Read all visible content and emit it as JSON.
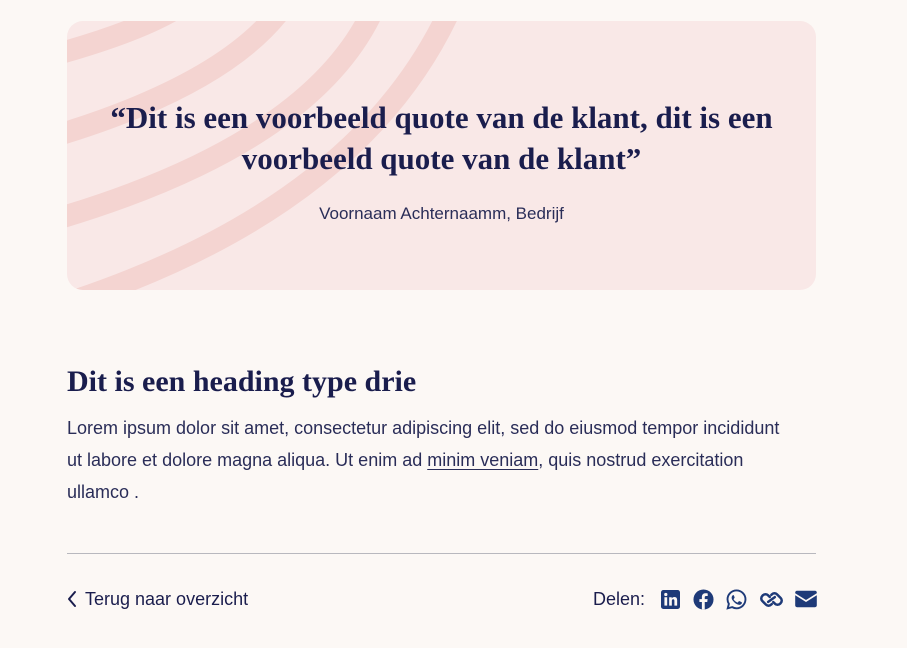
{
  "quote": {
    "text": "“Dit is een voorbeeld quote van de klant, dit is een voorbeeld quote van de klant”",
    "author": "Voornaam Achternaamm, Bedrijf"
  },
  "article": {
    "heading": "Dit is een heading type drie",
    "body_before_link": "Lorem ipsum dolor sit amet, consectetur adipiscing elit, sed do eiusmod tempor incididunt ut labore et dolore magna aliqua. Ut enim ad ",
    "link_text": "minim veniam",
    "body_after_link": ", quis nostrud exercitation ullamco ."
  },
  "footer": {
    "back_label": "Terug naar overzicht",
    "share_label": "Delen:",
    "share_icons": [
      "linkedin-icon",
      "facebook-icon",
      "whatsapp-icon",
      "link-icon",
      "email-icon"
    ]
  },
  "colors": {
    "background": "#fcf8f5",
    "card": "#f9e8e7",
    "card_stripes": "#f4d3d1",
    "text": "#1a1d4d",
    "icons": "#1e3a78",
    "divider": "#b8b8be"
  }
}
